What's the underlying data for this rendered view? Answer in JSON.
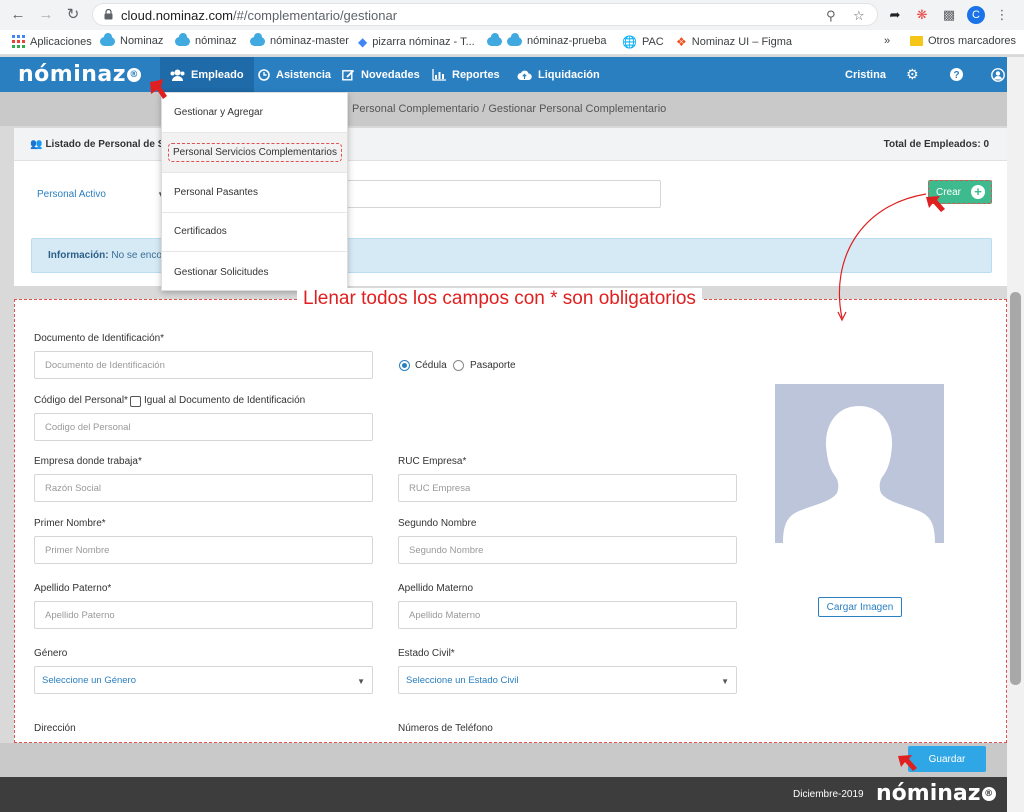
{
  "browser": {
    "url_host": "cloud.nominaz.com",
    "url_path": "/#/complementario/gestionar",
    "bookmarks": [
      "Aplicaciones",
      "Nominaz",
      "nóminaz",
      "nóminaz-master",
      "pizarra nóminaz - T...",
      "nóminaz-prueba",
      "PAC",
      "Nominaz UI – Figma"
    ],
    "bookmarks_more": "»",
    "other_bookmarks": "Otros marcadores",
    "profile_initial": "C"
  },
  "app": {
    "logo_text": "nóminaz",
    "logo_badge": "®",
    "nav": [
      "Empleado",
      "Asistencia",
      "Novedades",
      "Reportes",
      "Liquidación"
    ],
    "user": "Cristina"
  },
  "breadcrumb": "Personal Complementario / Gestionar Personal Complementario",
  "dropdown": [
    "Gestionar y Agregar",
    "Personal Servicios Complementarios",
    "Personal Pasantes",
    "Certificados",
    "Gestionar Solicitudes"
  ],
  "panel": {
    "title": "Listado de Personal de Ser",
    "total": "Total de Empleados: 0",
    "filter": "Personal Activo",
    "create_label": "Crear",
    "info_label": "Información:",
    "info_text": "No se encon"
  },
  "form": {
    "title": "Llenar todos los campos con * son obligatorios",
    "doc_label": "Documento de Identificación*",
    "doc_placeholder": "Documento de Identificación",
    "radio_cedula": "Cédula",
    "radio_pasaporte": "Pasaporte",
    "code_label": "Código del Personal*",
    "same_doc_label": "Igual al Documento de Identificación",
    "code_placeholder": "Codigo del Personal",
    "company_label": "Empresa donde trabaja*",
    "company_placeholder": "Razón Social",
    "ruc_label": "RUC Empresa*",
    "ruc_placeholder": "RUC Empresa",
    "first_name_label": "Primer Nombre*",
    "first_name_placeholder": "Primer Nombre",
    "second_name_label": "Segundo Nombre",
    "second_name_placeholder": "Segundo Nombre",
    "last1_label": "Apellido Paterno*",
    "last1_placeholder": "Apellido Paterno",
    "last2_label": "Apellido Materno",
    "last2_placeholder": "Apellido Materno",
    "gender_label": "Género",
    "gender_value": "Seleccione un Género",
    "civil_label": "Estado Civil*",
    "civil_value": "Seleccione un Estado Civil",
    "address_label": "Dirección",
    "phones_label": "Números de Teléfono",
    "upload_label": "Cargar Imagen"
  },
  "save_label": "Guardar",
  "footer": {
    "date": "Diciembre-2019",
    "logo_text": "nóminaz"
  },
  "colors": {
    "brand_blue": "#2a7fc1",
    "create_green": "#3dbb8f",
    "annotation_red": "#e02020",
    "save_blue": "#2fa6e5"
  }
}
